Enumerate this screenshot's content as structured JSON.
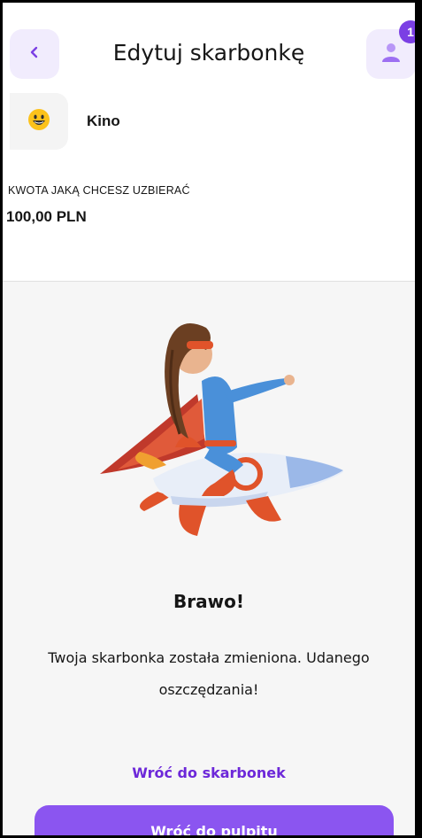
{
  "header": {
    "title": "Edytuj skarbonkę",
    "back_icon": "chevron-left-icon",
    "profile_icon": "user-icon",
    "notification_count": "1"
  },
  "piggy": {
    "icon": "smiley-emoji-icon",
    "name": "Kino"
  },
  "amount": {
    "label": "KWOTA JAKĄ CHCESZ UZBIERAĆ",
    "value": "100,00 PLN"
  },
  "success": {
    "title": "Brawo!",
    "message": "Twoja skarbonka została zmieniona. Udanego oszczędzania!",
    "link_label": "Wróć do skarbonek",
    "button_label": "Wróć do pulpitu"
  },
  "colors": {
    "accent": "#8b55f0",
    "accent_dark": "#6d28d9",
    "soft_accent": "#f1ecfd",
    "sheet_bg": "#f6f6f6"
  }
}
